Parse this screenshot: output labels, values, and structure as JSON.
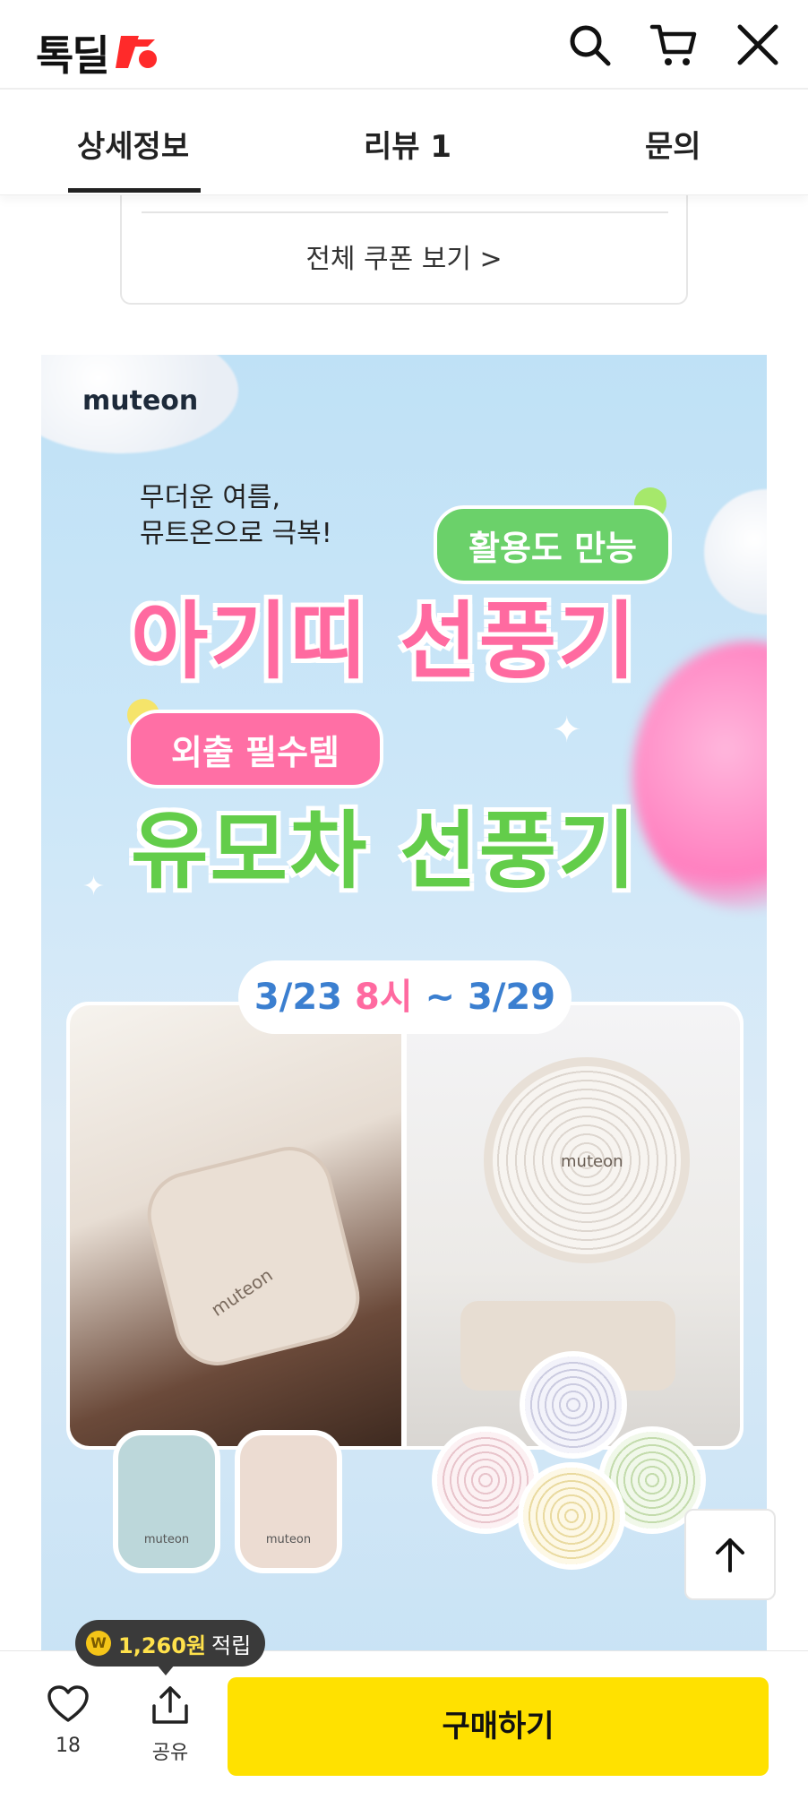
{
  "header": {
    "logo_text": "톡딜",
    "icons": [
      "search-icon",
      "cart-icon",
      "close-icon"
    ]
  },
  "tabs": [
    {
      "label": "상세정보",
      "active": true
    },
    {
      "label": "리뷰 1"
    },
    {
      "label": "문의"
    }
  ],
  "coupon": {
    "link_label": "전체 쿠폰 보기 >"
  },
  "banner": {
    "brand": "muteon",
    "tagline_line1": "무더운 여름,",
    "tagline_line2": "뮤트온으로 극복!",
    "pill_green": "활용도 만능",
    "headline1": "아기띠 선풍기",
    "pill_pink": "외출 필수템",
    "headline2": "유모차 선풍기",
    "date_start": "3/23",
    "date_time": "8시",
    "date_sep": " ~ ",
    "date_end": "3/29",
    "product_label_left": "muteon",
    "product_label_right": "muteon",
    "case_label_blue": "muteon",
    "case_label_beige": "muteon"
  },
  "points": {
    "amount": "1,260원",
    "suffix": "적립"
  },
  "bottom_bar": {
    "like_count": "18",
    "share_label": "공유",
    "buy_label": "구매하기"
  },
  "colors": {
    "buy_button": "#ffe100",
    "logo_accent": "#ff2a2a",
    "headline_pink": "#ff6aa0",
    "headline_green": "#63cd4a"
  }
}
